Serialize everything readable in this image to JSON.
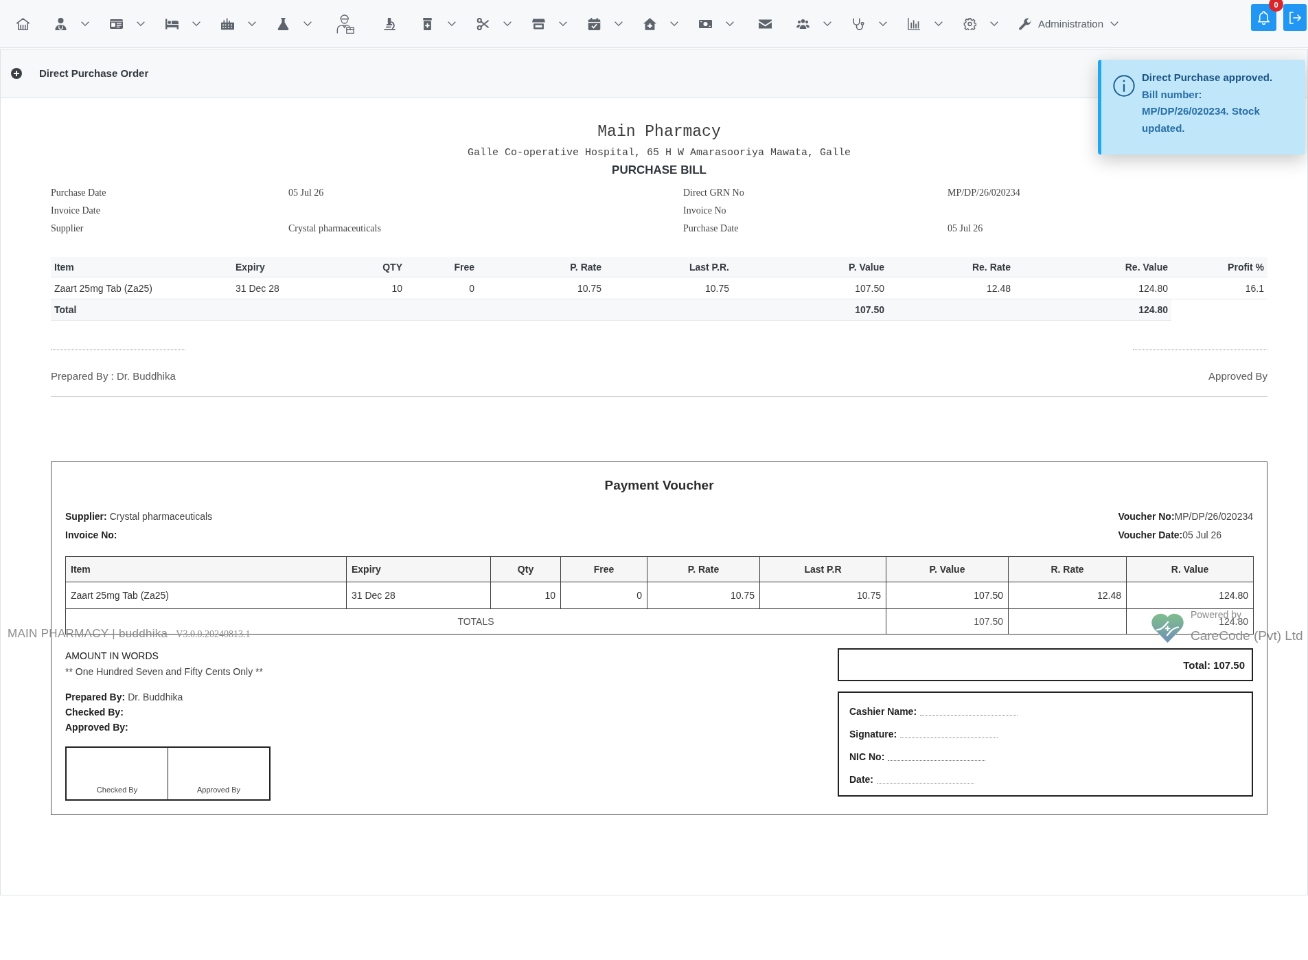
{
  "navbar": {
    "menu": [
      {
        "dropdown": false
      },
      {
        "dropdown": true
      },
      {
        "dropdown": true
      },
      {
        "dropdown": true
      },
      {
        "dropdown": true
      },
      {
        "dropdown": true
      },
      {
        "dropdown": false
      },
      {
        "dropdown": false
      },
      {
        "dropdown": true
      },
      {
        "dropdown": true
      },
      {
        "dropdown": true
      },
      {
        "dropdown": true
      },
      {
        "dropdown": true
      },
      {
        "dropdown": true
      },
      {
        "dropdown": false
      },
      {
        "dropdown": true
      },
      {
        "dropdown": true
      },
      {
        "dropdown": true
      },
      {
        "dropdown": true
      },
      {
        "label": "Administration",
        "dropdown": true
      }
    ],
    "notification_count": "0"
  },
  "page": {
    "title": "Direct Purchase Order"
  },
  "toast": {
    "summary": "Direct Purchase approved.",
    "detail": "Bill number: MP/DP/26/020234. Stock updated."
  },
  "purchase_bill": {
    "pharmacy": "Main Pharmacy",
    "address": "Galle Co-operative Hospital, 65 H W Amarasooriya Mawata, Galle",
    "title": "PURCHASE BILL",
    "details_left": [
      {
        "label": "Purchase Date",
        "value": "05 Jul 26"
      },
      {
        "label": "Invoice Date"
      },
      {
        "label": "Supplier",
        "value": "Crystal pharmaceuticals"
      }
    ],
    "details_right": [
      {
        "label": "Direct GRN No",
        "value": "MP/DP/26/020234"
      },
      {
        "label": "Invoice No"
      },
      {
        "label": "Purchase Date",
        "value": "05 Jul 26"
      }
    ],
    "table": {
      "columns": [
        "Item",
        "Expiry",
        "QTY",
        "Free",
        "P. Rate",
        "Last P.R.",
        "P. Value",
        "Re. Rate",
        "Re. Value",
        "Profit %"
      ],
      "rows": [
        [
          "Zaart 25mg Tab (Za25)",
          "31 Dec 28",
          "10",
          "0",
          "10.75",
          "10.75",
          "107.50",
          "12.48",
          "124.80",
          "16.1"
        ]
      ],
      "total": {
        "label": "Total",
        "p_value": "107.50",
        "re_value": "124.80"
      }
    },
    "prepared_by": "Prepared By : Dr. Buddhika",
    "approved_by": "Approved By"
  },
  "payment_voucher": {
    "title": "Payment Voucher",
    "info_left": [
      {
        "label": "Supplier:",
        "value": "Crystal pharmaceuticals"
      },
      {
        "label": "Invoice No:"
      }
    ],
    "info_right": [
      {
        "label": "Voucher No:",
        "value": "MP/DP/26/020234"
      },
      {
        "label": "Voucher Date:",
        "value": "05 Jul 26"
      }
    ],
    "table": {
      "columns": [
        "Item",
        "Expiry",
        "Qty",
        "Free",
        "P. Rate",
        "Last P.R",
        "P. Value",
        "R. Rate",
        "R. Value"
      ],
      "rows": [
        [
          "Zaart 25mg Tab (Za25)",
          "31 Dec 28",
          "10",
          "0",
          "10.75",
          "10.75",
          "107.50",
          "12.48",
          "124.80"
        ]
      ],
      "totals": {
        "label": "TOTALS",
        "p_value": "107.50",
        "r_value": "124.80"
      }
    },
    "amount_in_words": {
      "heading": "AMOUNT IN WORDS",
      "text": "** One Hundred Seven and Fifty Cents Only **"
    },
    "signatories": [
      {
        "label": "Prepared By:",
        "value": "Dr. Buddhika"
      },
      {
        "label": "Checked By:"
      },
      {
        "label": "Approved By:"
      }
    ],
    "signature_boxes": [
      "Checked By",
      "Approved By"
    ],
    "total": "Total: 107.50",
    "cashier_fields": [
      "Cashier Name:",
      "Signature:",
      "NIC No:",
      "Date:"
    ]
  },
  "footer": {
    "app": "MAIN PHARMACY | buddhika",
    "version": "V3.0.0.20240813.1",
    "powered_by": "Powered by",
    "company": "CareCode (Pvt) Ltd"
  }
}
